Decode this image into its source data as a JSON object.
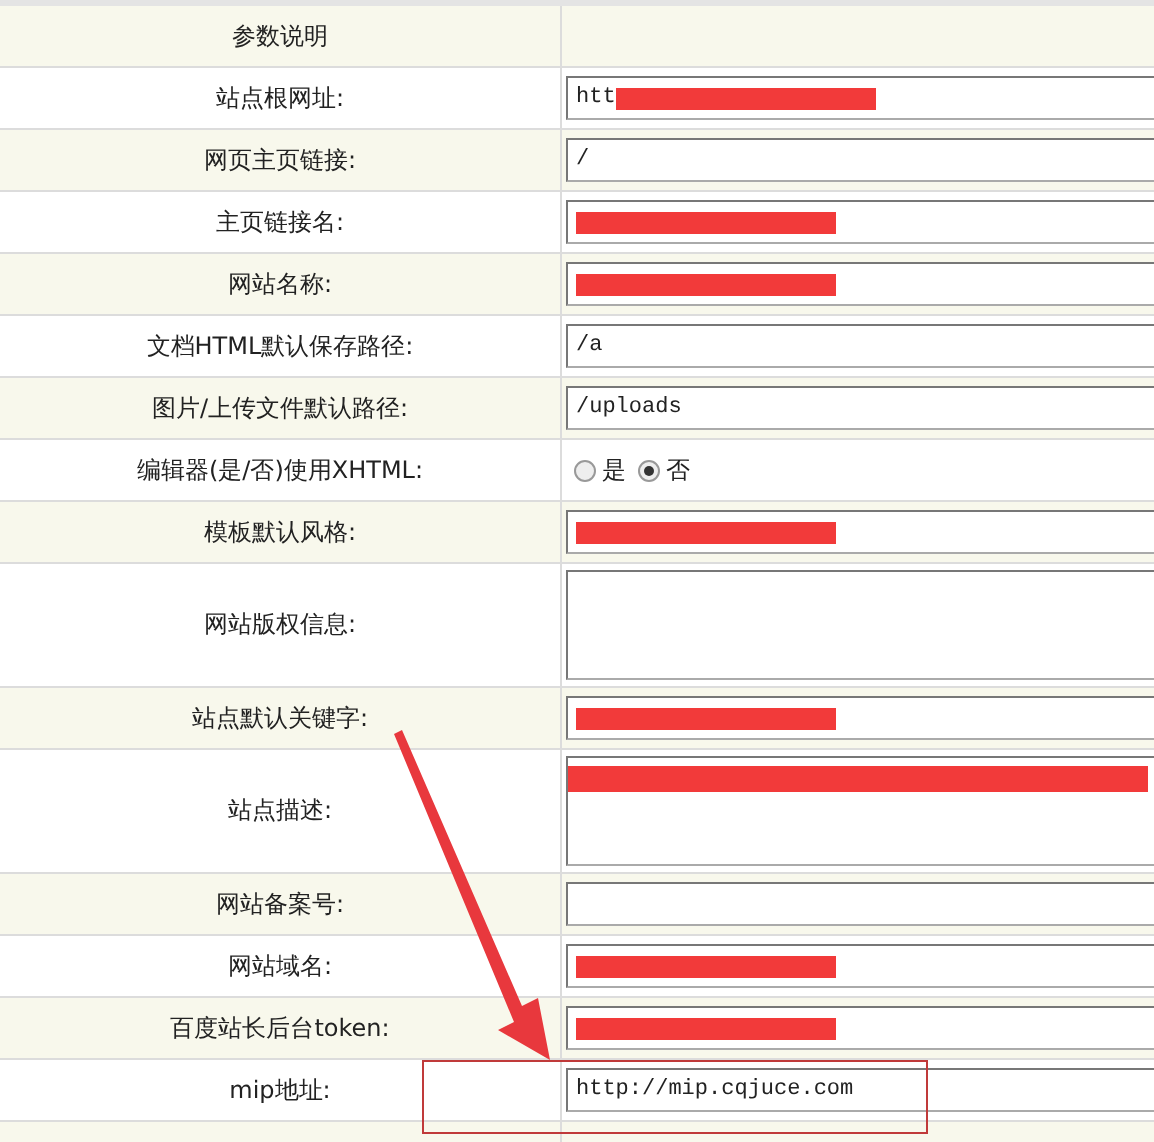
{
  "header": {
    "label": "参数说明"
  },
  "rows": [
    {
      "label": "站点根网址:",
      "kind": "text",
      "value": "htt",
      "redacted": true
    },
    {
      "label": "网页主页链接:",
      "kind": "text",
      "value": "/"
    },
    {
      "label": "主页链接名:",
      "kind": "text",
      "redacted": true
    },
    {
      "label": "网站名称:",
      "kind": "text",
      "redacted": true
    },
    {
      "label": "文档HTML默认保存路径:",
      "kind": "text",
      "value": "/a"
    },
    {
      "label": "图片/上传文件默认路径:",
      "kind": "text",
      "value": "/uploads"
    },
    {
      "label": "编辑器(是/否)使用XHTML:",
      "kind": "radio",
      "options": [
        {
          "label": "是",
          "selected": false
        },
        {
          "label": "否",
          "selected": true
        }
      ]
    },
    {
      "label": "模板默认风格:",
      "kind": "text",
      "redacted": true
    },
    {
      "label": "网站版权信息:",
      "kind": "textarea"
    },
    {
      "label": "站点默认关键字:",
      "kind": "text",
      "redacted": true
    },
    {
      "label": "站点描述:",
      "kind": "textarea",
      "redacted": true
    },
    {
      "label": "网站备案号:",
      "kind": "text"
    },
    {
      "label": "网站域名:",
      "kind": "text",
      "redacted": true
    },
    {
      "label": "百度站长后台token:",
      "kind": "text",
      "redacted": true
    },
    {
      "label": "mip地址:",
      "kind": "text",
      "value": "http://mip.cqjuce.com",
      "highlighted": true
    }
  ],
  "annotations": [
    {
      "kind": "arrow"
    }
  ]
}
